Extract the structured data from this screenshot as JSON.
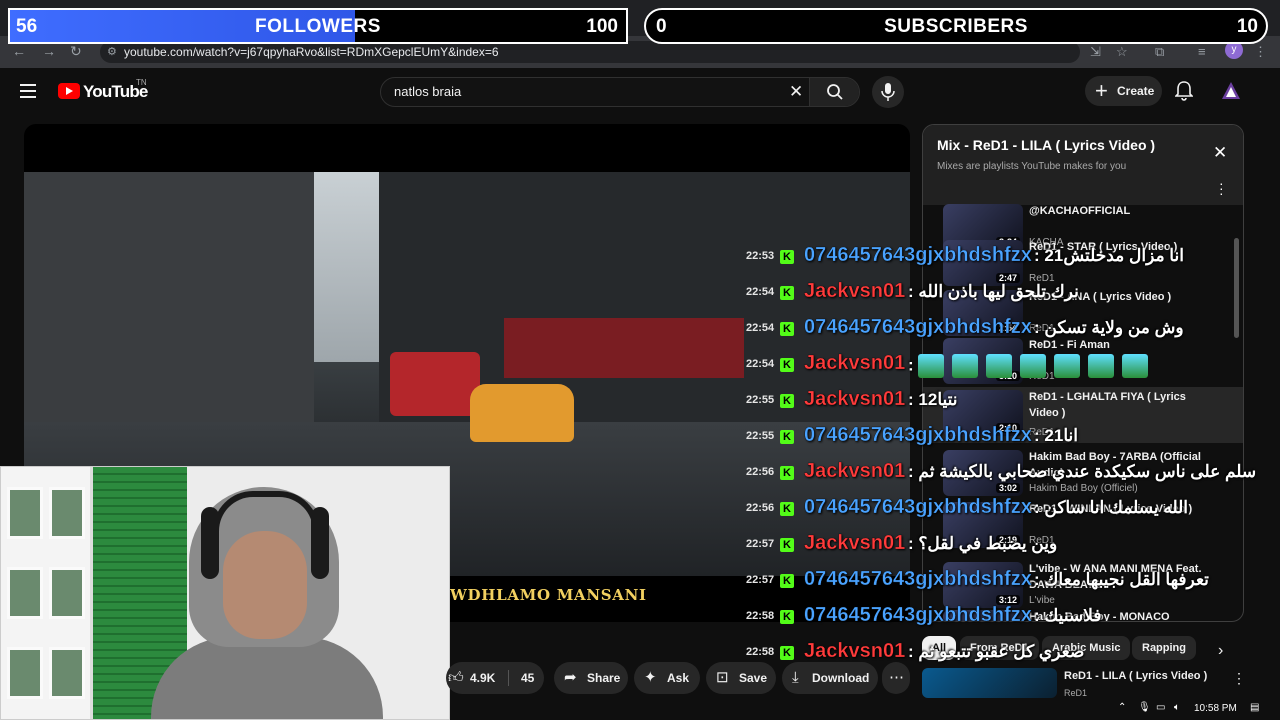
{
  "overlay": {
    "followers": {
      "current": "56",
      "label": "FOLLOWERS",
      "goal": "100",
      "fill_ratio": 0.56
    },
    "subscribers": {
      "current": "0",
      "label": "SUBSCRIBERS",
      "goal": "10"
    }
  },
  "browser": {
    "url": "youtube.com/watch?v=j67qpyhaRvo&list=RDmXGepclEUmY&index=6",
    "profile_initial": "y"
  },
  "youtube": {
    "logo_text": "YouTube",
    "logo_tm": "TN",
    "search_query": "natlos braia",
    "create_label": "Create"
  },
  "video": {
    "lyric_overlay": "WDHLAMO MANSANI"
  },
  "actions": {
    "likes": "4.9K",
    "dislikes": "45",
    "share": "Share",
    "ask": "Ask",
    "save": "Save",
    "download": "Download"
  },
  "playlist": {
    "title": "Mix - ReD1 - LILA ( Lyrics Video )",
    "subtitle": "Mixes are playlists YouTube makes for you",
    "items": [
      {
        "title": "@KACHAOFFICIAL",
        "channel": "KACHA",
        "duration": "3:34"
      },
      {
        "title": "ReD1 - STAR ( Lyrics Video )",
        "channel": "ReD1",
        "duration": "2:47"
      },
      {
        "title": "ReD1 - ANA ( Lyrics Video )",
        "channel": "ReD1",
        "duration": "2:54"
      },
      {
        "title": "ReD1 - Fi Aman",
        "channel": "ReD1",
        "duration": "3:10"
      },
      {
        "title": "ReD1 - LGHALTA FIYA ( Lyrics Video )",
        "channel": "ReD1",
        "duration": "2:10"
      },
      {
        "title": "Hakim Bad Boy - 7ARBA (Official Audio)",
        "channel": "Hakim Bad Boy (Officiel)",
        "duration": "3:02"
      },
      {
        "title": "ReD1 - WINLAN ( Lyrics Video )",
        "channel": "ReD1",
        "duration": "2:19"
      },
      {
        "title": "L'vibe - W ANA MANI MENA Feat. DAWA BEATS",
        "channel": "L'vibe",
        "duration": "3:12"
      },
      {
        "title": "Hakim Bad Boy - MONACO",
        "channel": "Hakim Bad Boy",
        "duration": "2:58"
      }
    ],
    "chips": [
      "All",
      "From ReD1",
      "Arabic Music",
      "Rapping"
    ],
    "next": {
      "title": "ReD1 - LILA ( Lyrics Video )",
      "channel": "ReD1"
    }
  },
  "chat": [
    {
      "time": "22:53",
      "user": "0746457643gjxbhdshfzx",
      "text": ": انا مزال مدخلتش21",
      "color": "#4aa3ff"
    },
    {
      "time": "22:54",
      "user": "Jackvsn01",
      "text": ": نرك تلحق ليها باذن الله",
      "color": "#ff3b3b"
    },
    {
      "time": "22:54",
      "user": "0746457643gjxbhdshfzx",
      "text": ": وش من ولاية تسكن",
      "color": "#4aa3ff"
    },
    {
      "time": "22:54",
      "user": "Jackvsn01",
      "text": ":",
      "color": "#ff3b3b",
      "emotes": 7
    },
    {
      "time": "22:55",
      "user": "Jackvsn01",
      "text": ": نتيا12",
      "color": "#ff3b3b"
    },
    {
      "time": "22:55",
      "user": "0746457643gjxbhdshfzx",
      "text": ": انا21",
      "color": "#4aa3ff"
    },
    {
      "time": "22:56",
      "user": "Jackvsn01",
      "text": ": سلم على ناس سكيكدة عندي صحابي بالكيشة ثم",
      "color": "#ff3b3b"
    },
    {
      "time": "22:56",
      "user": "0746457643gjxbhdshfzx",
      "text": ": الله يسلمك انا ساكن",
      "color": "#4aa3ff"
    },
    {
      "time": "22:57",
      "user": "Jackvsn01",
      "text": ": وين يضبط في لقل؟",
      "color": "#ff3b3b"
    },
    {
      "time": "22:57",
      "user": "0746457643gjxbhdshfzx",
      "text": ": تعرفها القل نجيبها معاك",
      "color": "#4aa3ff"
    },
    {
      "time": "22:58",
      "user": "0746457643gjxbhdshfzx",
      "text": ": فلاسنيك",
      "color": "#4aa3ff"
    },
    {
      "time": "22:58",
      "user": "Jackvsn01",
      "text": ": صغري كل عقبو تتبعو ثم",
      "color": "#ff3b3b"
    }
  ],
  "tray": {
    "time": "10:58 PM"
  }
}
